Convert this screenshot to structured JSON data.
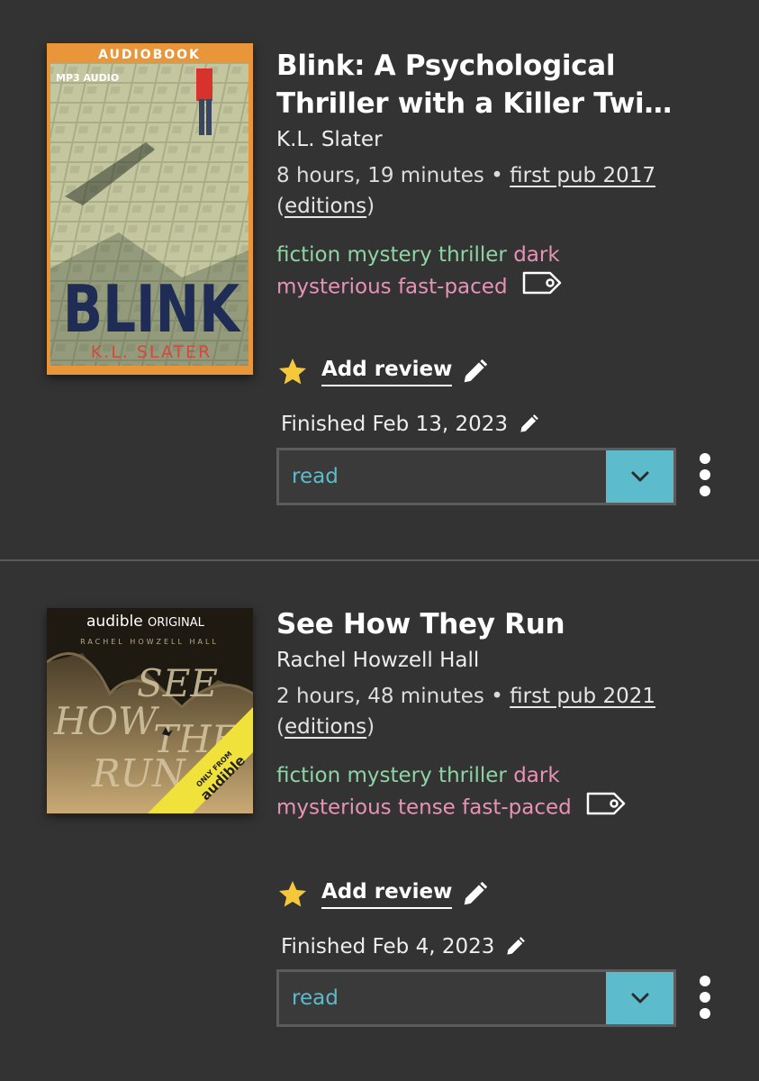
{
  "colors": {
    "background": "#333333",
    "genre_tag": "#8fd4a4",
    "mood_tag": "#e892b6",
    "status_accent": "#5cbccb",
    "star": "#f5c83b"
  },
  "books": [
    {
      "cover": {
        "badge": "AUDIOBOOK",
        "sub_badge": "MP3 AUDIO",
        "title_text": "BLINK",
        "author_text": "K.L. SLATER"
      },
      "title_line1": "Blink: A Psychological",
      "title_line2": "Thriller with a Killer Twi…",
      "author": "K.L. Slater",
      "duration": "8 hours, 19 minutes",
      "first_pub": "first pub 2017",
      "editions_label": "editions",
      "genre_tags": "fiction mystery thriller",
      "mood_tags_line1": "dark",
      "mood_tags_line2": "mysterious fast-paced",
      "tag_icon": "tag-icon",
      "review_label": "Add review",
      "finished": "Finished Feb 13, 2023",
      "status": "read"
    },
    {
      "cover": {
        "brand": "audible",
        "brand_suffix": "ORIGINAL",
        "author_text": "RACHEL HOWZELL HALL",
        "title_words": [
          "SEE",
          "HOW",
          "THEY",
          "RUN"
        ],
        "sash_top": "ONLY FROM",
        "sash_brand": "audible"
      },
      "title_line1": "See How They Run",
      "author": "Rachel Howzell Hall",
      "duration": "2 hours, 48 minutes",
      "first_pub": "first pub 2021",
      "editions_label": "editions",
      "genre_tags": "fiction mystery thriller",
      "mood_tags_line1": "dark",
      "mood_tags_line2": "mysterious tense fast-paced",
      "tag_icon": "tag-icon",
      "review_label": "Add review",
      "finished": "Finished Feb 4, 2023",
      "status": "read"
    }
  ]
}
